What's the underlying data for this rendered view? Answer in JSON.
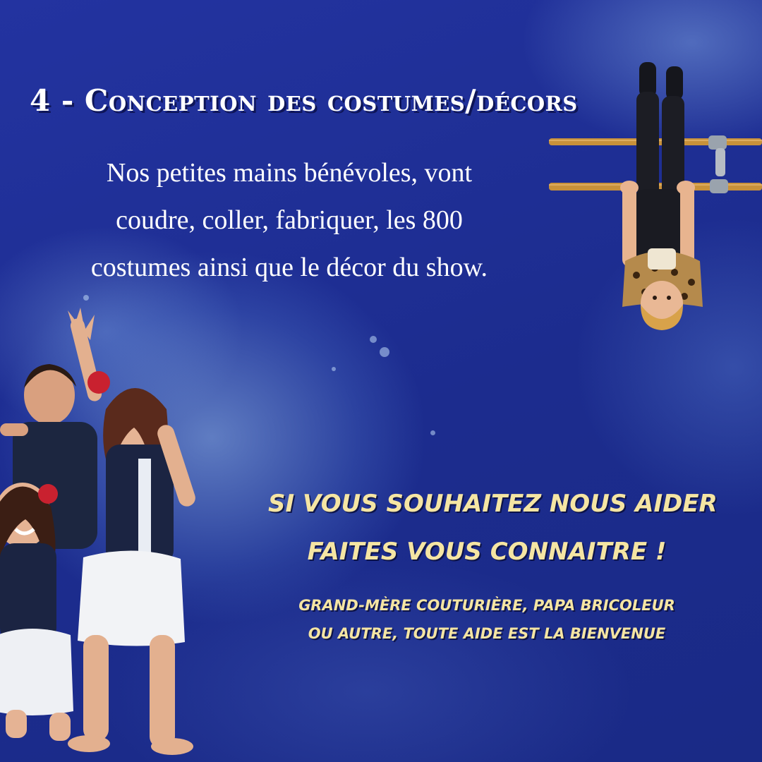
{
  "heading": {
    "title": "4 - Conception des costumes/décors"
  },
  "body": {
    "lines": [
      "Nos petites mains bénévoles, vont",
      "coudre, coller, fabriquer, les 800",
      "costumes ainsi que le décor du show."
    ]
  },
  "call_to_action": {
    "line1": "SI VOUS SOUHAITEZ NOUS AIDER",
    "line2": "FAITES VOUS CONNAITRE !",
    "line3": "GRAND-MÈRE COUTURIÈRE, PAPA BRICOLEUR",
    "line4": "OU AUTRE, TOUTE AIDE EST LA BIENVENUE"
  },
  "colors": {
    "background": "#1f2f92",
    "title": "#ffffff",
    "accent_text": "#f5e5a3"
  },
  "images": {
    "kids_photo": "children-dancing-photo",
    "gymnast_photo": "child-hanging-upside-down-on-bars-photo"
  }
}
